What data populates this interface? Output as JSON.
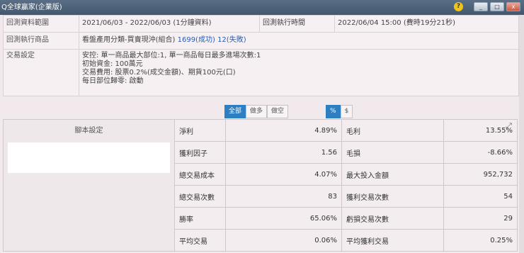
{
  "window": {
    "title": "Q全球贏家(企業版)",
    "help_label": "?",
    "min_label": "_",
    "max_label": "□",
    "close_label": "x"
  },
  "info": {
    "range_label": "回測資料範圍",
    "range_value": "2021/06/03 - 2022/06/03 (1分鐘資料)",
    "exec_time_label": "回測執行時間",
    "exec_time_value": "2022/06/04 15:00 (費時19分21秒)",
    "product_label": "回測執行商品",
    "product_name": "看盤產用分類-買賣現沖(組合)",
    "product_success": "1699(成功)",
    "product_fail": "12(失敗)",
    "trade_label": "交易設定",
    "trade_lines": [
      "安控: 單一商品最大部位:1, 單一商品每日最多進場次數:1",
      "初始資金: 100萬元",
      "交易費用: 股票0.2%(成交金額)、期貨100元(口)",
      "每日部位歸零: 啟動"
    ]
  },
  "filters": {
    "all": "全部",
    "long": "做多",
    "short": "做空",
    "percent": "%",
    "dollar": "$"
  },
  "stats": {
    "script_label": "腳本設定",
    "expand_icon": "expand-icon",
    "rows": [
      {
        "k1": "淨利",
        "v1": "4.89%",
        "k2": "毛利",
        "v2": "13.55%"
      },
      {
        "k1": "獲利因子",
        "v1": "1.56",
        "k2": "毛損",
        "v2": "-8.66%"
      },
      {
        "k1": "總交易成本",
        "v1": "4.07%",
        "k2": "最大投入金額",
        "v2": "952,732"
      },
      {
        "k1": "總交易次數",
        "v1": "83",
        "k2": "獲利交易次數",
        "v2": "54"
      },
      {
        "k1": "勝率",
        "v1": "65.06%",
        "k2": "虧損交易次數",
        "v2": "29"
      },
      {
        "k1": "平均交易",
        "v1": "0.06%",
        "k2": "平均獲利交易",
        "v2": "0.25%"
      }
    ]
  },
  "colors": {
    "accent": "#2e7fc1",
    "negative": "#d0302b",
    "link": "#2a5db0"
  }
}
